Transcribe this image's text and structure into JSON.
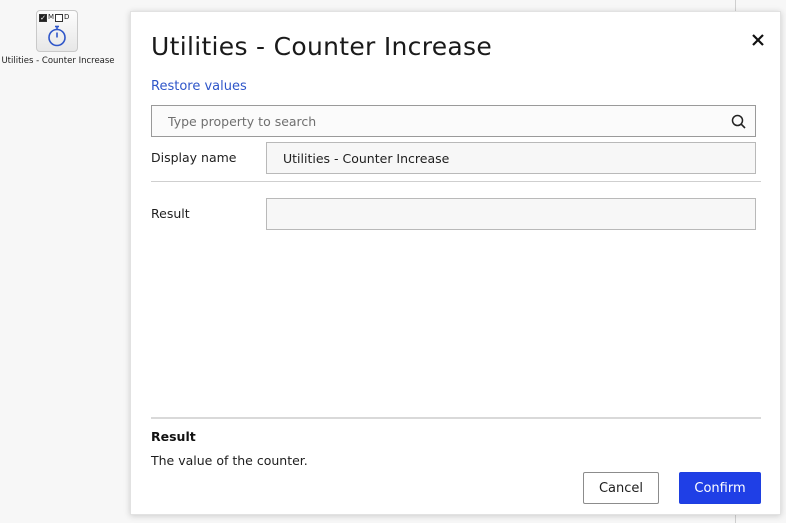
{
  "canvas": {
    "node": {
      "flag_m": "M",
      "flag_d": "D",
      "m_checked": true,
      "d_checked": false,
      "icon": "stopwatch-icon",
      "label": "Utilities - Counter Increase"
    }
  },
  "dialog": {
    "title": "Utilities - Counter Increase",
    "close_icon": "close-icon",
    "restore_label": "Restore values",
    "search": {
      "placeholder": "Type property to search",
      "value": "",
      "icon": "search-icon"
    },
    "properties": [
      {
        "label": "Display name",
        "value": "Utilities - Counter Increase"
      },
      {
        "label": "Result",
        "value": ""
      }
    ],
    "help": {
      "title": "Result",
      "text": "The value of the counter."
    },
    "buttons": {
      "cancel": "Cancel",
      "confirm": "Confirm"
    },
    "colors": {
      "accent": "#1f3fe6",
      "link": "#2f56c9"
    }
  }
}
